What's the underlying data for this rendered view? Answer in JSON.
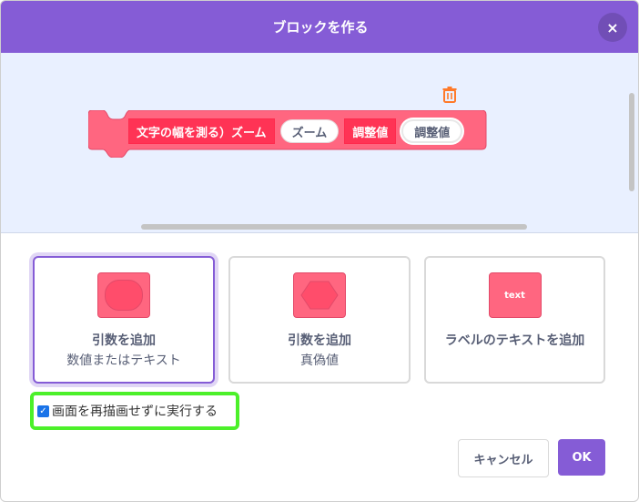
{
  "dialog": {
    "title": "ブロックを作る",
    "close_symbol": "×"
  },
  "block": {
    "segments": [
      {
        "kind": "label",
        "text": "文字の幅を測る）ズーム"
      },
      {
        "kind": "input",
        "text": "ズーム"
      },
      {
        "kind": "label",
        "text": "調整値"
      },
      {
        "kind": "input",
        "text": "調整値",
        "selected": true
      }
    ],
    "delete_icon": "trash-icon"
  },
  "options": [
    {
      "title": "引数を追加",
      "subtitle": "数値またはテキスト",
      "icon": "rounded-input-icon",
      "active": true
    },
    {
      "title": "引数を追加",
      "subtitle": "真偽値",
      "icon": "boolean-input-icon",
      "active": false
    },
    {
      "title": "ラベルのテキストを追加",
      "subtitle": "",
      "icon": "text-label-icon",
      "icon_text": "text",
      "active": false
    }
  ],
  "checkbox": {
    "label": "画面を再描画せずに実行する",
    "checked": true
  },
  "buttons": {
    "cancel": "キャンセル",
    "ok": "OK"
  },
  "colors": {
    "header": "#855cd6",
    "block": "#ff6680",
    "highlight": "#4cf02a"
  }
}
